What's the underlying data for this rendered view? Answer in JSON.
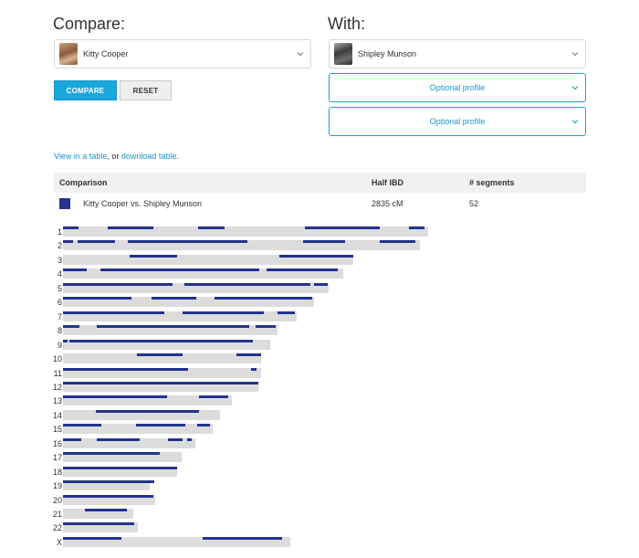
{
  "compare": {
    "heading": "Compare:",
    "profile": {
      "name": "Kitty Cooper"
    },
    "compare_label": "COMPARE",
    "reset_label": "RESET"
  },
  "with": {
    "heading": "With:",
    "profile": {
      "name": "Shipley Munson"
    },
    "optional_1": "Optional profile",
    "optional_2": "Optional profile"
  },
  "links": {
    "view_table": "View in a table",
    "separator": ", or ",
    "download_table": "download table",
    "end": "."
  },
  "table": {
    "headers": {
      "comparison": "Comparison",
      "half_ibd": "Half IBD",
      "segments": "# segments"
    },
    "row": {
      "comparison": "Kitty Cooper vs. Shipley Munson",
      "half_ibd": "2835 cM",
      "segments": "52",
      "color": "#24328c"
    }
  },
  "colors": {
    "accent": "#1aa7de",
    "segment": "#24328c",
    "chromosome": "#dcdcdc"
  },
  "icons": {
    "select_toggle": "chevron-down-icon"
  },
  "chromosomes": [
    {
      "label": "1",
      "length_mb": 249,
      "segments": [
        [
          0.0,
          10.7
        ],
        [
          30.4,
          61.4
        ],
        [
          92.2,
          110.0
        ],
        [
          164.8,
          216.0
        ],
        [
          235.6,
          245.9
        ]
      ]
    },
    {
      "label": "2",
      "length_mb": 243,
      "segments": [
        [
          0.0,
          7.0
        ],
        [
          10.2,
          36.0
        ],
        [
          44.3,
          125.8
        ],
        [
          163.7,
          192.0
        ],
        [
          215.5,
          240.0
        ]
      ]
    },
    {
      "label": "3",
      "length_mb": 198,
      "segments": [
        [
          45.2,
          77.5
        ],
        [
          147.6,
          198.0
        ]
      ]
    },
    {
      "label": "4",
      "length_mb": 191,
      "segments": [
        [
          0.0,
          16.2
        ],
        [
          25.8,
          134.0
        ],
        [
          138.5,
          187.0
        ]
      ]
    },
    {
      "label": "5",
      "length_mb": 181,
      "segments": [
        [
          0.0,
          74.4
        ],
        [
          82.5,
          168.3
        ],
        [
          170.8,
          180.0
        ]
      ]
    },
    {
      "label": "6",
      "length_mb": 171,
      "segments": [
        [
          0.0,
          46.7
        ],
        [
          60.4,
          91.0
        ],
        [
          103.3,
          170.0
        ]
      ]
    },
    {
      "label": "7",
      "length_mb": 159,
      "segments": [
        [
          0.0,
          68.8
        ],
        [
          81.4,
          136.9
        ],
        [
          146.3,
          158.0
        ]
      ]
    },
    {
      "label": "8",
      "length_mb": 146,
      "segments": [
        [
          0.0,
          11.0
        ],
        [
          22.9,
          126.5
        ],
        [
          131.4,
          145.0
        ]
      ]
    },
    {
      "label": "9",
      "length_mb": 141,
      "segments": [
        [
          0.0,
          3.0
        ],
        [
          4.5,
          129.6
        ]
      ]
    },
    {
      "label": "10",
      "length_mb": 135,
      "segments": [
        [
          50.6,
          81.4
        ],
        [
          118.4,
          135.0
        ]
      ]
    },
    {
      "label": "11",
      "length_mb": 135,
      "segments": [
        [
          0.0,
          85.5
        ],
        [
          128.1,
          132.0
        ]
      ]
    },
    {
      "label": "12",
      "length_mb": 133,
      "segments": [
        [
          0.0,
          133.0
        ]
      ]
    },
    {
      "label": "13",
      "length_mb": 115,
      "segments": [
        [
          0.0,
          71.2
        ],
        [
          92.8,
          112.5
        ]
      ]
    },
    {
      "label": "14",
      "length_mb": 107,
      "segments": [
        [
          22.3,
          92.8
        ]
      ]
    },
    {
      "label": "15",
      "length_mb": 102,
      "segments": [
        [
          0.0,
          26.0
        ],
        [
          49.5,
          83.1
        ],
        [
          91.2,
          100.0
        ]
      ]
    },
    {
      "label": "16",
      "length_mb": 90,
      "segments": [
        [
          0.0,
          12.4
        ],
        [
          22.9,
          52.0
        ],
        [
          71.8,
          82.0
        ],
        [
          84.8,
          88.0
        ]
      ]
    },
    {
      "label": "17",
      "length_mb": 81,
      "segments": [
        [
          0.0,
          65.9
        ]
      ]
    },
    {
      "label": "18",
      "length_mb": 78,
      "segments": [
        [
          0.0,
          78.0
        ]
      ]
    },
    {
      "label": "19",
      "length_mb": 59,
      "segments": [
        [
          0.0,
          62.2
        ]
      ]
    },
    {
      "label": "20",
      "length_mb": 63,
      "segments": [
        [
          0.0,
          61.6
        ]
      ]
    },
    {
      "label": "21",
      "length_mb": 48,
      "segments": [
        [
          14.9,
          43.3
        ]
      ]
    },
    {
      "label": "22",
      "length_mb": 51,
      "segments": [
        [
          0.0,
          48.7
        ]
      ]
    },
    {
      "label": "X",
      "length_mb": 155,
      "segments": [
        [
          0.0,
          39.6
        ],
        [
          95.3,
          149.7
        ]
      ]
    }
  ]
}
